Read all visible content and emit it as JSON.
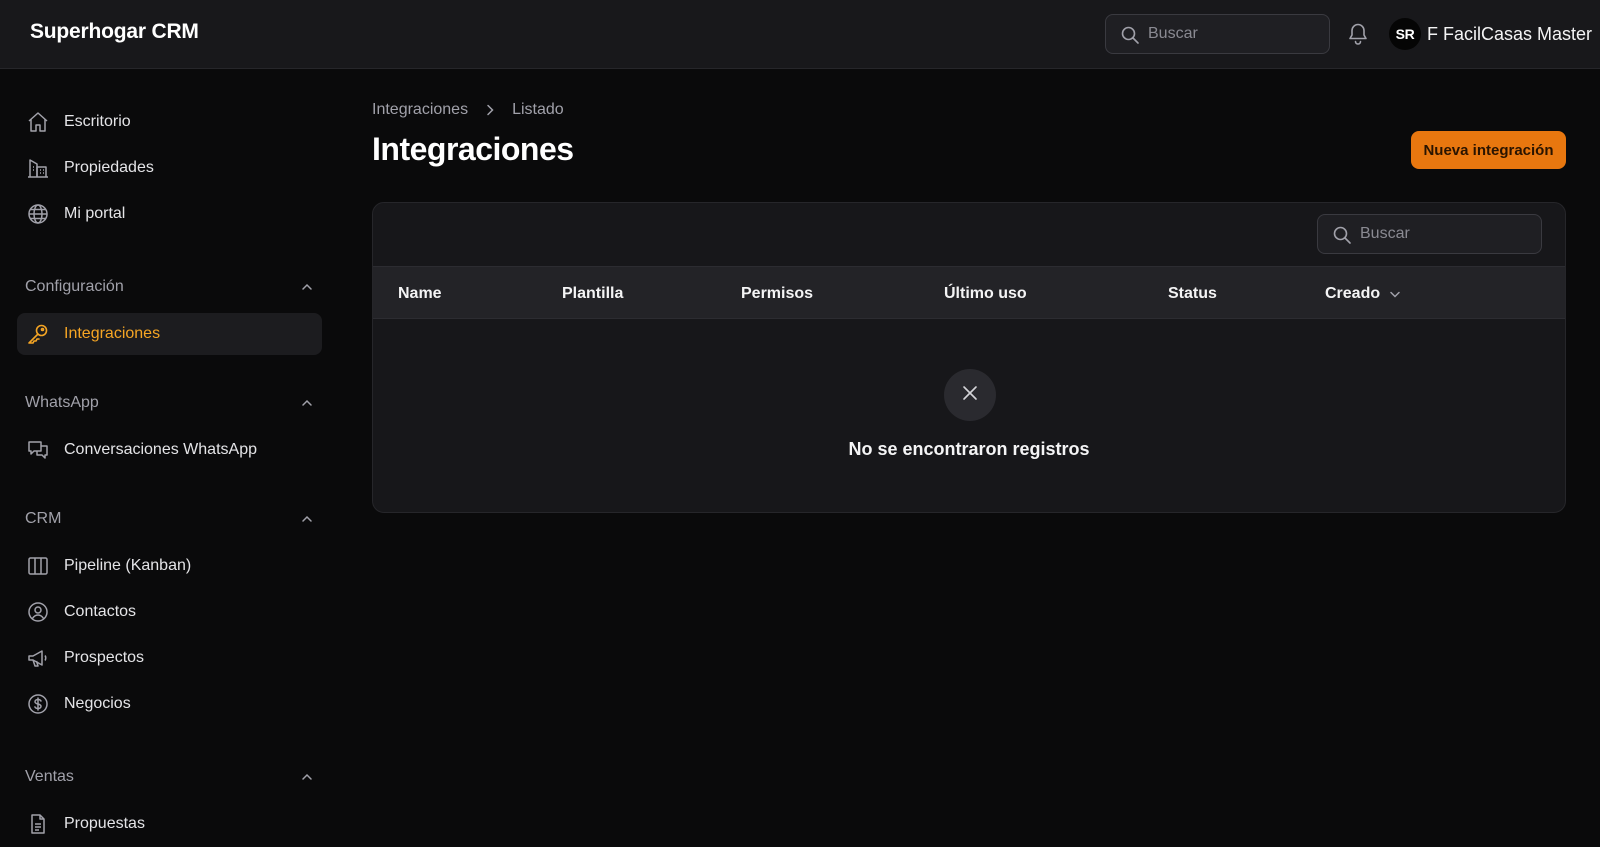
{
  "app": {
    "brand": "Superhogar CRM"
  },
  "topbar": {
    "search_placeholder": "Buscar",
    "user": {
      "initials": "SR",
      "name": "F FacilCasas Master"
    }
  },
  "sidebar": {
    "items_main": [
      {
        "label": "Escritorio",
        "icon": "home-icon"
      },
      {
        "label": "Propiedades",
        "icon": "building-icon"
      },
      {
        "label": "Mi portal",
        "icon": "globe-icon"
      }
    ],
    "groups": [
      {
        "label": "Configuración",
        "items": [
          {
            "label": "Integraciones",
            "icon": "key-icon",
            "active": true
          }
        ]
      },
      {
        "label": "WhatsApp",
        "items": [
          {
            "label": "Conversaciones WhatsApp",
            "icon": "chat-icon"
          }
        ]
      },
      {
        "label": "CRM",
        "items": [
          {
            "label": "Pipeline (Kanban)",
            "icon": "columns-icon"
          },
          {
            "label": "Contactos",
            "icon": "user-circle-icon"
          },
          {
            "label": "Prospectos",
            "icon": "megaphone-icon"
          },
          {
            "label": "Negocios",
            "icon": "dollar-circle-icon"
          }
        ]
      },
      {
        "label": "Ventas",
        "items": [
          {
            "label": "Propuestas",
            "icon": "document-icon"
          }
        ]
      }
    ]
  },
  "breadcrumb": {
    "parent": "Integraciones",
    "current": "Listado"
  },
  "page": {
    "title": "Integraciones",
    "new_button": "Nueva integración"
  },
  "table": {
    "search_placeholder": "Buscar",
    "columns": [
      "Name",
      "Plantilla",
      "Permisos",
      "Último uso",
      "Status",
      "Creado"
    ],
    "sort_column": "Creado",
    "empty_message": "No se encontraron registros"
  },
  "colors": {
    "accent": "#e8770f",
    "active_text": "#f5a524",
    "background": "#0a0a0b"
  }
}
